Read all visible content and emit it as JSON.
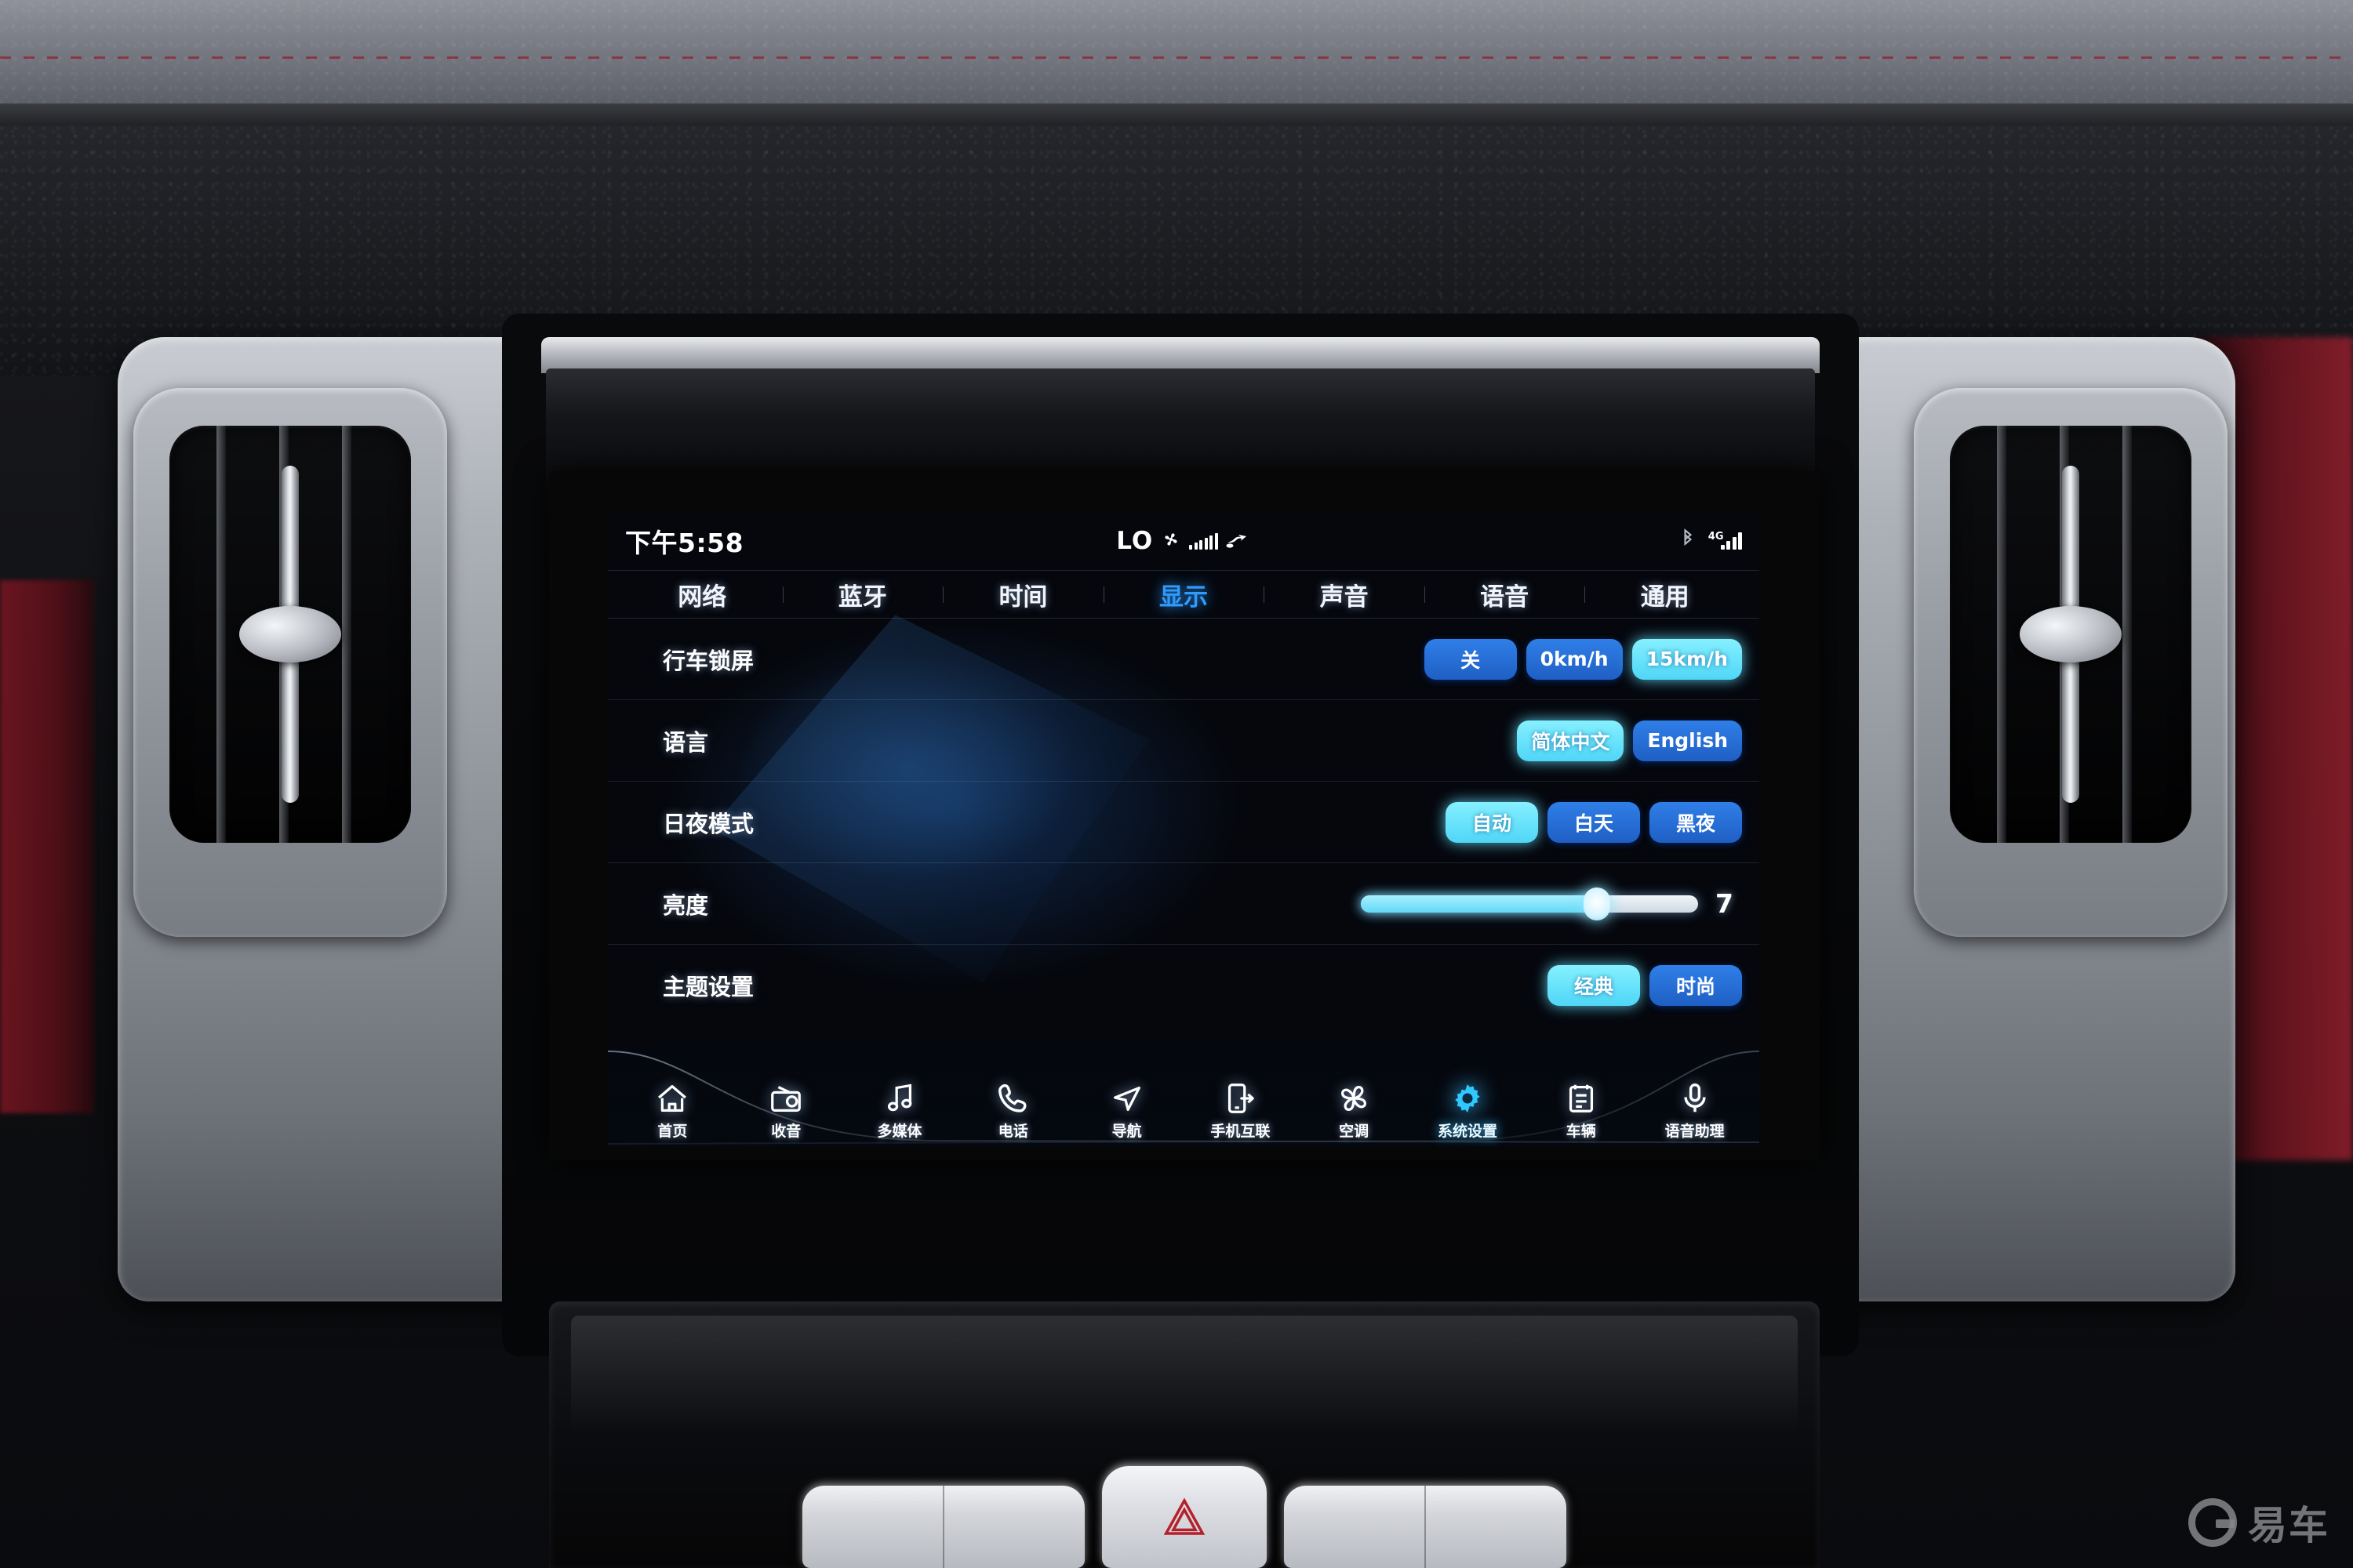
{
  "statusbar": {
    "time": "下午5:58",
    "climate_temp": "LO",
    "fan_icon": "fan-icon",
    "fan_level_bars": 6,
    "airflow_icon": "airflow-seat-icon",
    "bluetooth_icon": "bluetooth-icon",
    "network_label": "4G",
    "signal_bars": 4
  },
  "tabs": [
    {
      "label": "网络",
      "active": false,
      "name": "tab-network"
    },
    {
      "label": "蓝牙",
      "active": false,
      "name": "tab-bluetooth"
    },
    {
      "label": "时间",
      "active": false,
      "name": "tab-time"
    },
    {
      "label": "显示",
      "active": true,
      "name": "tab-display"
    },
    {
      "label": "声音",
      "active": false,
      "name": "tab-sound"
    },
    {
      "label": "语音",
      "active": false,
      "name": "tab-voice"
    },
    {
      "label": "通用",
      "active": false,
      "name": "tab-general"
    }
  ],
  "rows": [
    {
      "name": "row-driving-lockscreen",
      "label": "行车锁屏",
      "type": "segments",
      "options": [
        {
          "label": "关",
          "selected": false
        },
        {
          "label": "0km/h",
          "selected": false
        },
        {
          "label": "15km/h",
          "selected": true
        }
      ]
    },
    {
      "name": "row-language",
      "label": "语言",
      "type": "segments",
      "options": [
        {
          "label": "简体中文",
          "selected": true
        },
        {
          "label": "English",
          "selected": false
        }
      ]
    },
    {
      "name": "row-day-night-mode",
      "label": "日夜模式",
      "type": "segments",
      "options": [
        {
          "label": "自动",
          "selected": true
        },
        {
          "label": "白天",
          "selected": false
        },
        {
          "label": "黑夜",
          "selected": false
        }
      ]
    },
    {
      "name": "row-brightness",
      "label": "亮度",
      "type": "slider",
      "value": 7,
      "value_text": "7",
      "percent": 70
    },
    {
      "name": "row-theme",
      "label": "主题设置",
      "type": "segments",
      "options": [
        {
          "label": "经典",
          "selected": true
        },
        {
          "label": "时尚",
          "selected": false
        }
      ]
    }
  ],
  "dock": [
    {
      "label": "首页",
      "icon": "home-icon",
      "name": "dock-item-home",
      "active": false
    },
    {
      "label": "收音",
      "icon": "radio-icon",
      "name": "dock-item-radio",
      "active": false
    },
    {
      "label": "多媒体",
      "icon": "music-note-icon",
      "name": "dock-item-media",
      "active": false
    },
    {
      "label": "电话",
      "icon": "phone-icon",
      "name": "dock-item-phone",
      "active": false
    },
    {
      "label": "导航",
      "icon": "navigation-icon",
      "name": "dock-item-navigation",
      "active": false
    },
    {
      "label": "手机互联",
      "icon": "phone-link-icon",
      "name": "dock-item-phone-link",
      "active": false
    },
    {
      "label": "空调",
      "icon": "fan-icon",
      "name": "dock-item-climate",
      "active": false
    },
    {
      "label": "系统设置",
      "icon": "gear-icon",
      "name": "dock-item-settings",
      "active": true
    },
    {
      "label": "车辆",
      "icon": "checklist-icon",
      "name": "dock-item-vehicle",
      "active": false
    },
    {
      "label": "语音助理",
      "icon": "microphone-icon",
      "name": "dock-item-voice",
      "active": false
    }
  ],
  "watermark": {
    "text": "易车",
    "logo": "yiche-logo-icon"
  },
  "colors": {
    "accent_active": "#4fd6f7",
    "accent_button": "#2f7fe8",
    "tab_active": "#2f9bff",
    "screen_bg": "#05070d",
    "text": "#ffffff"
  }
}
